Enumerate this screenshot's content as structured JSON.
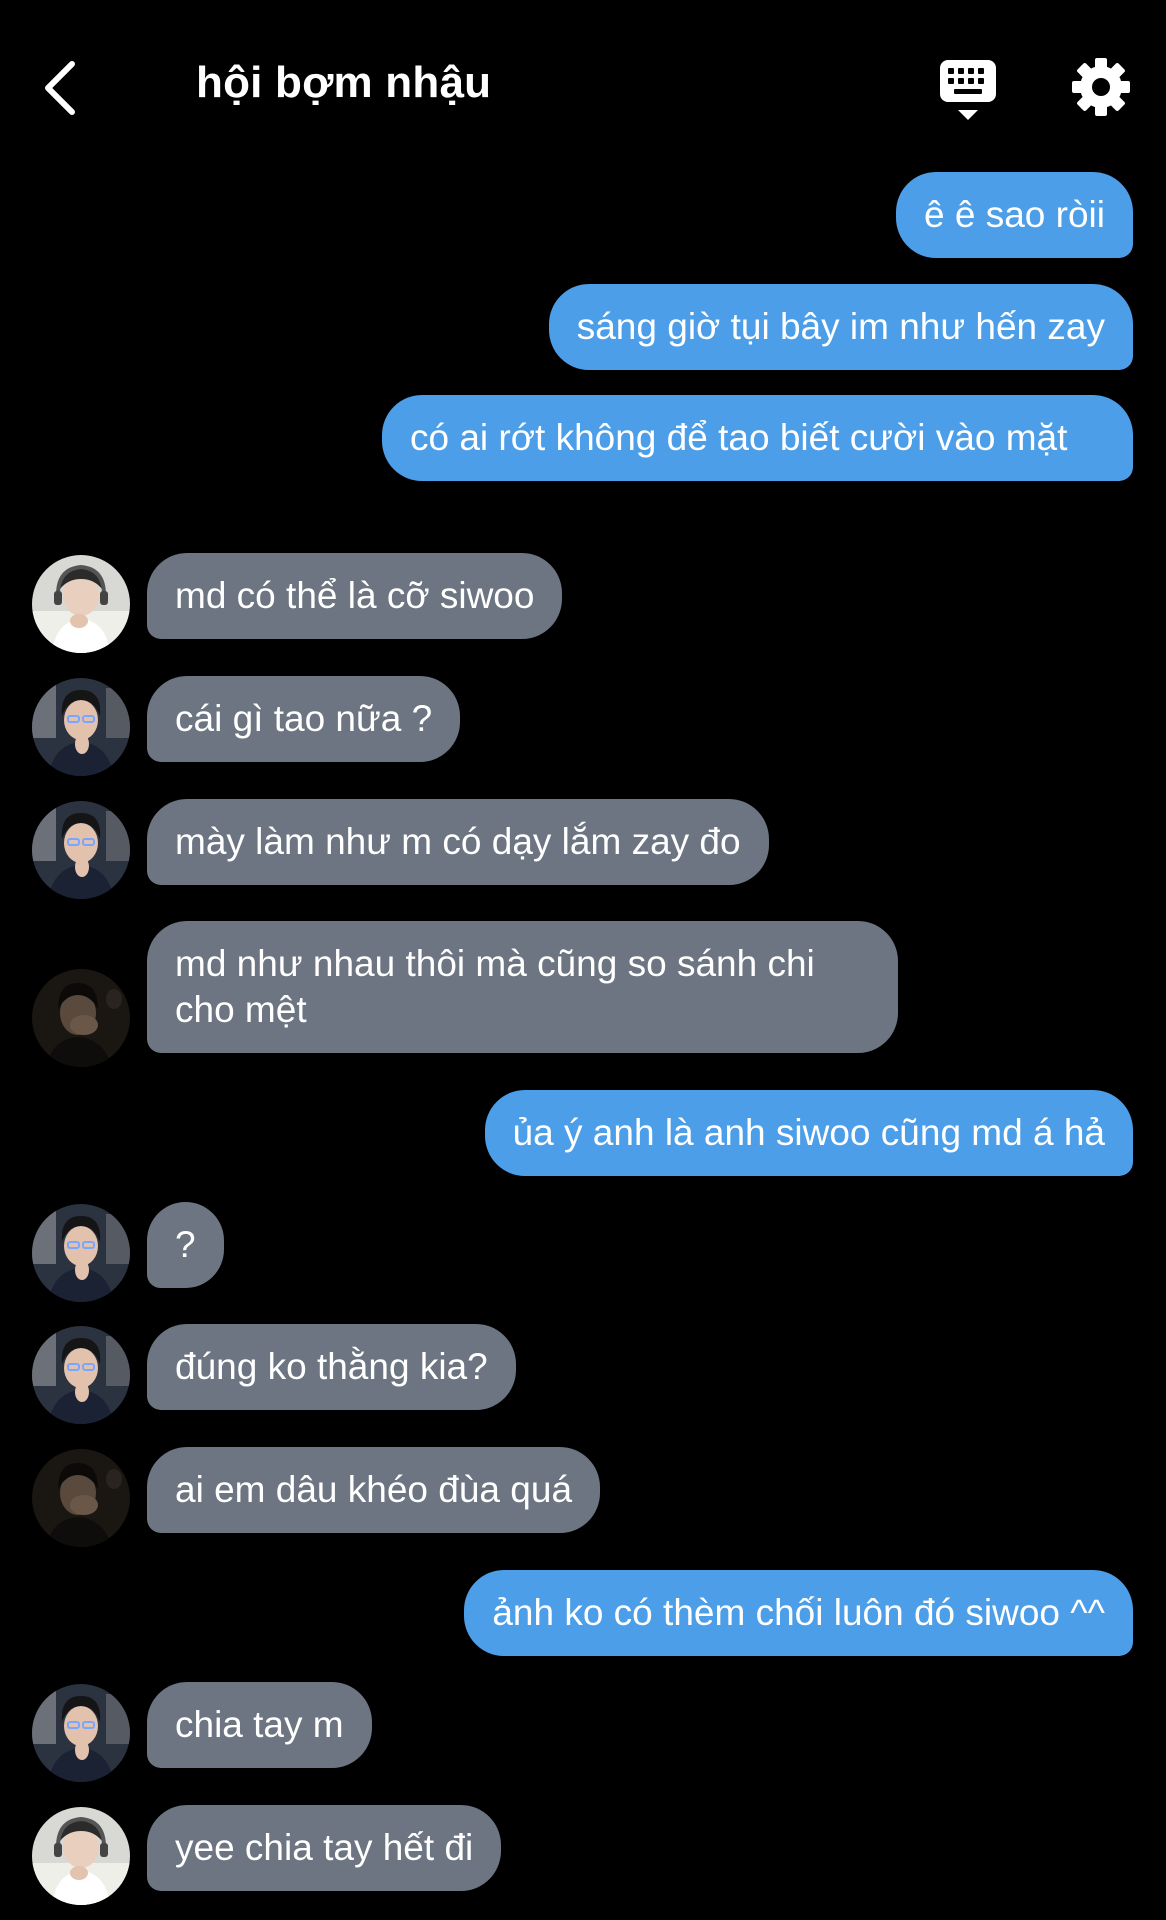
{
  "header": {
    "title": "hội bợm nhậu",
    "back_icon": "chevron-left-icon",
    "keyboard_icon": "keyboard-icon",
    "settings_icon": "gear-icon"
  },
  "colors": {
    "background": "#000000",
    "outgoing_bubble": "#4c9ee8",
    "incoming_bubble": "#6c7581",
    "text": "#ffffff"
  },
  "messages": [
    {
      "from": "me",
      "text": "ê ê sao ròii"
    },
    {
      "from": "me",
      "text": "sáng giờ tụi bây im như hến zay"
    },
    {
      "from": "me",
      "text": "có ai rớt không để tao biết cười vào mặt"
    },
    {
      "from": "them",
      "avatar": "headphones-boy",
      "text": "md có thể là cỡ siwoo"
    },
    {
      "from": "them",
      "avatar": "hand-chin-boy",
      "text": "cái gì tao nữa ?"
    },
    {
      "from": "them",
      "avatar": "hand-chin-boy",
      "text": "mày làm như m có dạy lắm zay đo"
    },
    {
      "from": "them",
      "avatar": "dark-portrait",
      "text": "md như nhau thôi mà cũng so sánh chi cho mệt"
    },
    {
      "from": "me",
      "text": "ủa ý anh là anh siwoo cũng md á hả"
    },
    {
      "from": "them",
      "avatar": "hand-chin-boy",
      "text": "?"
    },
    {
      "from": "them",
      "avatar": "hand-chin-boy",
      "text": "đúng ko thằng kia?"
    },
    {
      "from": "them",
      "avatar": "dark-portrait",
      "text": "ai em dâu khéo đùa quá"
    },
    {
      "from": "me",
      "text": "ảnh ko có thèm chối luôn đó siwoo ^^"
    },
    {
      "from": "them",
      "avatar": "hand-chin-boy",
      "text": "chia tay m"
    },
    {
      "from": "them",
      "avatar": "headphones-boy",
      "text": "yee chia tay hết đi"
    }
  ]
}
